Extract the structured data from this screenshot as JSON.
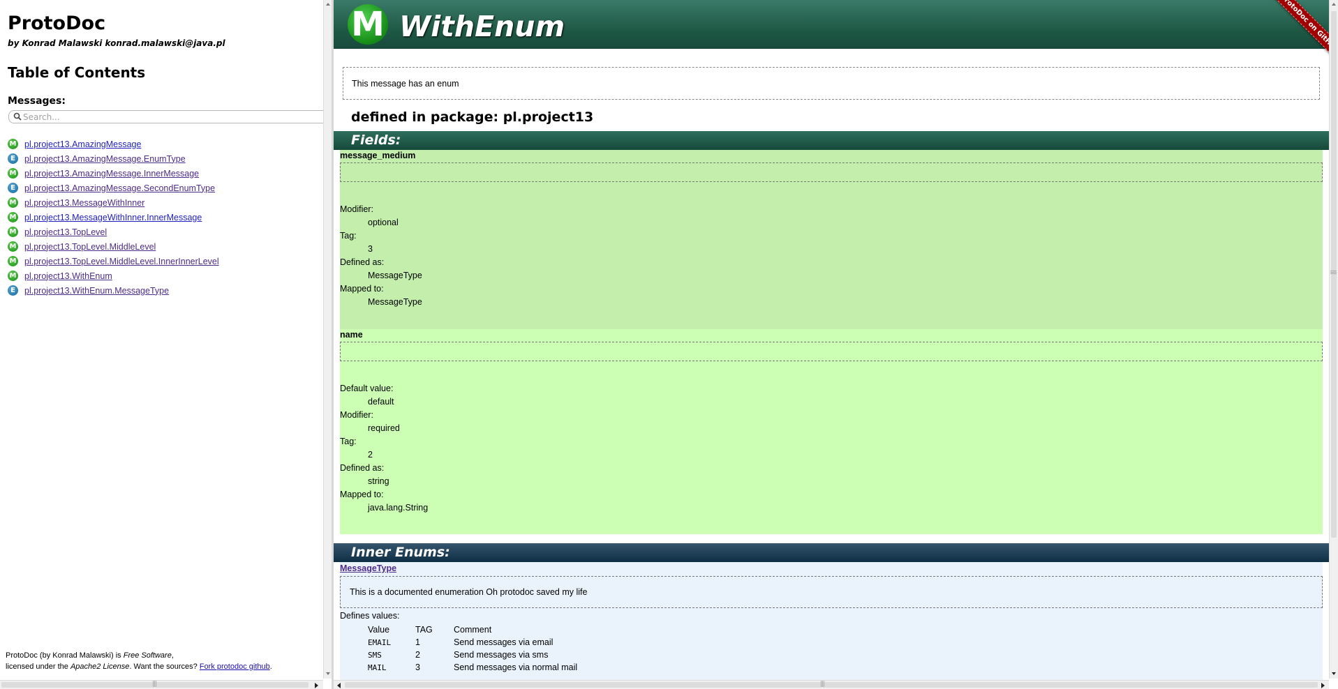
{
  "sidebar": {
    "title": "ProtoDoc",
    "author": "by Konrad Malawski konrad.malawski@java.pl",
    "toc_heading": "Table of Contents",
    "messages_label": "Messages:",
    "search_placeholder": "Search...",
    "items": [
      {
        "badge": "M",
        "label": "pl.project13.AmazingMessage"
      },
      {
        "badge": "E",
        "label": "pl.project13.AmazingMessage.EnumType"
      },
      {
        "badge": "M",
        "label": "pl.project13.AmazingMessage.InnerMessage"
      },
      {
        "badge": "E",
        "label": "pl.project13.AmazingMessage.SecondEnumType"
      },
      {
        "badge": "M",
        "label": "pl.project13.MessageWithInner"
      },
      {
        "badge": "M",
        "label": "pl.project13.MessageWithInner.InnerMessage"
      },
      {
        "badge": "M",
        "label": "pl.project13.TopLevel"
      },
      {
        "badge": "M",
        "label": "pl.project13.TopLevel.MiddleLevel"
      },
      {
        "badge": "M",
        "label": "pl.project13.TopLevel.MiddleLevel.InnerInnerLevel"
      },
      {
        "badge": "M",
        "label": "pl.project13.WithEnum"
      },
      {
        "badge": "E",
        "label": "pl.project13.WithEnum.MessageType"
      }
    ],
    "footer": {
      "line1_prefix": "ProtoDoc (by Konrad Malawski) is ",
      "free_software": "Free Software",
      "line1_suffix": ",",
      "line2_prefix": "licensed under the ",
      "license": "Apache2 License",
      "line2_middle": ". Want the sources? ",
      "fork_link": "Fork protodoc github",
      "line2_suffix": "."
    }
  },
  "main": {
    "logo_letter": "M",
    "title": "WithEnum",
    "ribbon": "ProtoDoc on GitHub",
    "description": "This message has an enum",
    "package": "defined in package: pl.project13",
    "fields_heading": "Fields:",
    "fields": [
      {
        "name": "message_medium",
        "props": [
          {
            "label": "Modifier:",
            "value": "optional"
          },
          {
            "label": "Tag:",
            "value": "3"
          },
          {
            "label": "Defined as:",
            "value": "MessageType"
          },
          {
            "label": "Mapped to:",
            "value": "MessageType"
          }
        ]
      },
      {
        "name": "name",
        "props": [
          {
            "label": "Default value:",
            "value": "default"
          },
          {
            "label": "Modifier:",
            "value": "required"
          },
          {
            "label": "Tag:",
            "value": "2"
          },
          {
            "label": "Defined as:",
            "value": "string"
          },
          {
            "label": "Mapped to:",
            "value": "java.lang.String"
          }
        ]
      }
    ],
    "inner_enums_heading": "Inner Enums:",
    "inner_enum": {
      "name": "MessageType",
      "description": "This is a documented enumeration Oh protodoc saved my life",
      "defines_label": "Defines values:",
      "columns": [
        "Value",
        "TAG",
        "Comment"
      ],
      "values": [
        {
          "value": "EMAIL",
          "tag": "1",
          "comment": "Send messages via email"
        },
        {
          "value": "SMS",
          "tag": "2",
          "comment": "Send messages via sms"
        },
        {
          "value": "MAIL",
          "tag": "3",
          "comment": "Send messages via normal mail"
        }
      ]
    }
  },
  "colors": {
    "header_green": "#1f5a46",
    "field_green_1": "#c3eeab",
    "field_green_2": "#ccffb3",
    "enum_bg": "#eaf2fc",
    "ribbon_red": "#a00000"
  }
}
